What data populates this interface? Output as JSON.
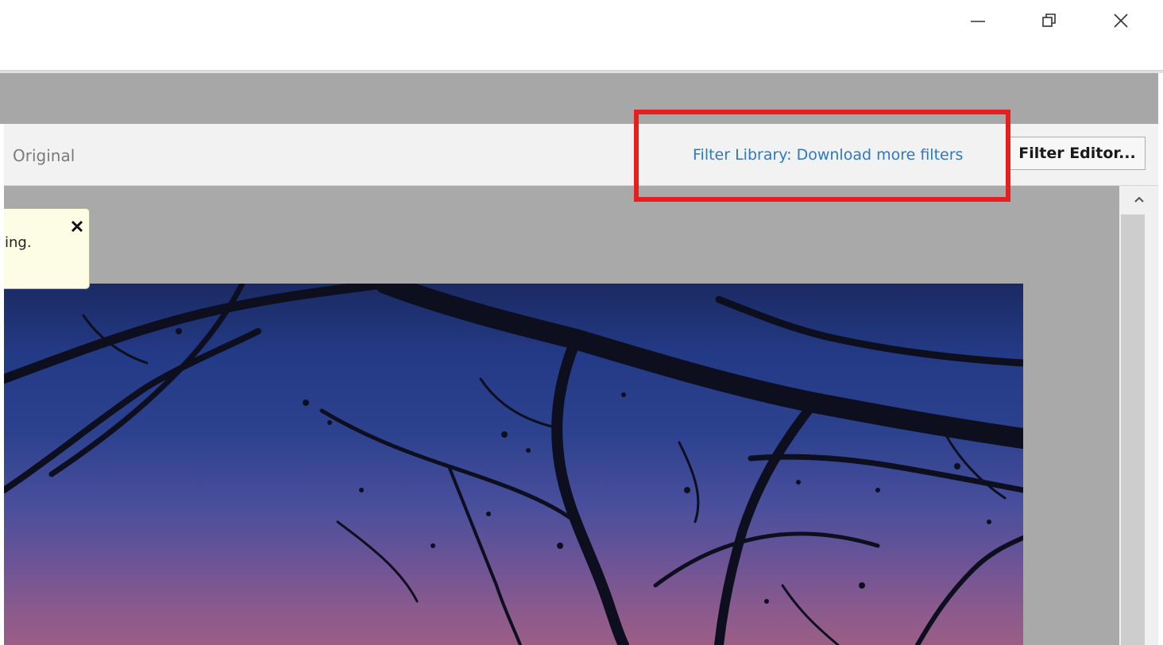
{
  "window_controls": {
    "minimize": "minimize-icon",
    "maximize": "restore-icon",
    "close": "close-icon"
  },
  "toolbar": {
    "original_label": "Original",
    "filter_library_link": "Filter Library: Download more filters",
    "filter_editor_button": "Filter Editor..."
  },
  "notification": {
    "text": "ing.",
    "close_icon": "close-x-icon"
  },
  "scrollbar": {
    "up_icon": "chevron-up-icon"
  },
  "annotation": {
    "highlight_color": "#e51f1f"
  },
  "colors": {
    "link": "#2a79c5",
    "band": "#a7a7a7",
    "toolbar": "#f2f2f2",
    "canvas": "#a9a9a9",
    "notice_bg": "#fdfce5"
  }
}
